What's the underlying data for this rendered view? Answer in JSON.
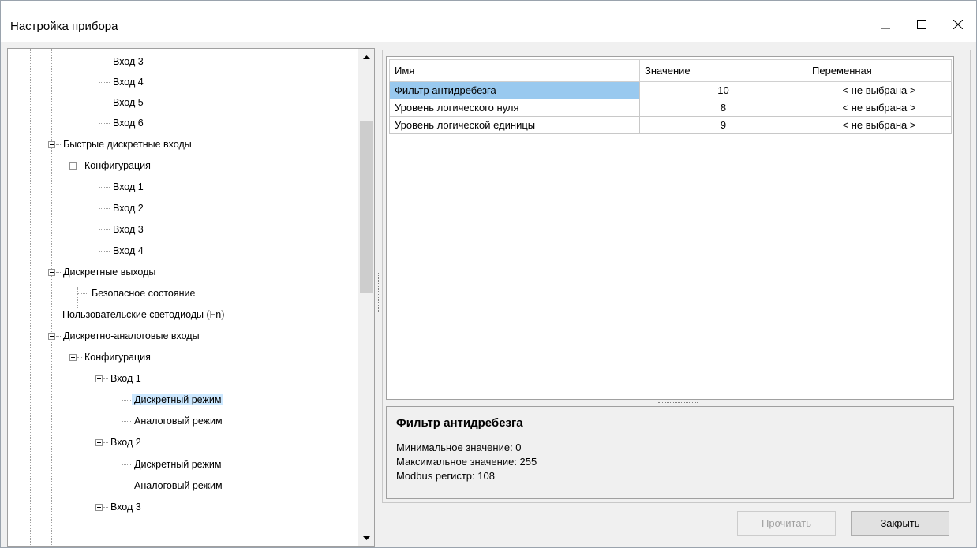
{
  "window": {
    "title": "Настройка прибора"
  },
  "tree": {
    "items": [
      {
        "label": "Вход 3",
        "level": 3
      },
      {
        "label": "Вход 4",
        "level": 3
      },
      {
        "label": "Вход 5",
        "level": 3
      },
      {
        "label": "Вход 6",
        "level": 3
      },
      {
        "label": "Быстрые дискретные входы",
        "level": 1
      },
      {
        "label": "Конфигурация",
        "level": 2
      },
      {
        "label": "Вход 1",
        "level": 3
      },
      {
        "label": "Вход 2",
        "level": 3
      },
      {
        "label": "Вход 3",
        "level": 3
      },
      {
        "label": "Вход 4",
        "level": 3
      },
      {
        "label": "Дискретные выходы",
        "level": 1
      },
      {
        "label": "Безопасное состояние",
        "level": 2
      },
      {
        "label": "Пользовательские светодиоды (Fn)",
        "level": 1
      },
      {
        "label": "Дискретно-аналоговые входы",
        "level": 1
      },
      {
        "label": "Конфигурация",
        "level": 2
      },
      {
        "label": "Вход 1",
        "level": 3
      },
      {
        "label": "Дискретный режим",
        "level": 4,
        "selected": true
      },
      {
        "label": "Аналоговый режим",
        "level": 4
      },
      {
        "label": "Вход 2",
        "level": 3
      },
      {
        "label": "Дискретный режим",
        "level": 4
      },
      {
        "label": "Аналоговый режим",
        "level": 4
      },
      {
        "label": "Вход 3",
        "level": 3
      }
    ]
  },
  "grid": {
    "columns": [
      "Имя",
      "Значение",
      "Переменная"
    ],
    "rows": [
      {
        "name": "Фильтр антидребезга",
        "value": "10",
        "variable": "< не выбрана >"
      },
      {
        "name": "Уровень логического нуля",
        "value": "8",
        "variable": "< не выбрана >"
      },
      {
        "name": "Уровень логической единицы",
        "value": "9",
        "variable": "< не выбрана >"
      }
    ]
  },
  "description": {
    "title": "Фильтр антидребезга",
    "min": "Минимальное значение: 0",
    "max": "Максимальное значение: 255",
    "modbus": "Modbus регистр: 108"
  },
  "buttons": {
    "read": "Прочитать",
    "close": "Закрыть"
  }
}
